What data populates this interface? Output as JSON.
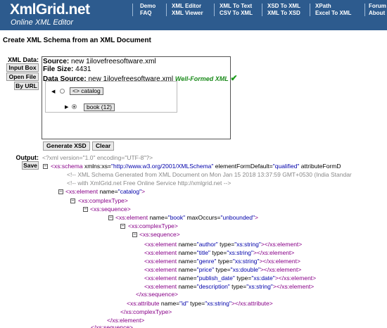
{
  "header": {
    "logo": "XmlGrid.net",
    "tagline": "Online XML Editor",
    "nav": [
      [
        "Demo",
        "FAQ"
      ],
      [
        "XML Editor",
        "XML Viewer"
      ],
      [
        "XML To Text",
        "CSV To XML"
      ],
      [
        "XSD To XML",
        "XML To XSD"
      ],
      [
        "XPath",
        "Excel To XML"
      ],
      [
        "Forum",
        "About"
      ]
    ]
  },
  "page_title": "Create XML Schema from an XML Document",
  "xml_data": {
    "label": "XML Data:",
    "buttons": {
      "input_box": "Input Box",
      "open_file": "Open File",
      "by_url": "By URL"
    },
    "source_label": "Source:",
    "source_value": "new 1ilovefreesoftware.xml",
    "filesize_label": "File Size:",
    "filesize_value": "4431",
    "datasource_label": "Data Source:",
    "datasource_value": "new 1ilovefreesoftware.xml",
    "wellformed": "Well-Formed XML",
    "checkmark": "✔",
    "tree": {
      "root": "<> catalog",
      "child": "book (12)"
    }
  },
  "actions": {
    "generate": "Generate XSD",
    "clear": "Clear"
  },
  "output": {
    "label": "Output:",
    "save": "Save",
    "lines": [
      [
        [
          "pi",
          "<?xml version=\"1.0\" encoding=\"UTF-8\"?>"
        ]
      ],
      [
        [
          "tg",
          "<xs:schema "
        ],
        [
          "at",
          "xmlns:xs="
        ],
        [
          "vl",
          "\"http://www.w3.org/2001/XMLSchema\""
        ],
        [
          "at",
          " elementFormDefault="
        ],
        [
          "vl",
          "\"qualified\""
        ],
        [
          "at",
          " attributeFormD"
        ]
      ],
      [
        [
          "cm",
          "<!-- XML Schema Generated from XML Document on Mon Jan 15 2018 13:37:59 GMT+0530 (India Standar"
        ]
      ],
      [
        [
          "cm",
          "<!-- with XmlGrid.net Free Online Service http://xmlgrid.net -->"
        ]
      ],
      [
        [
          "tg",
          "<xs:element "
        ],
        [
          "at",
          "name="
        ],
        [
          "vl",
          "\"catalog\""
        ],
        [
          "tg",
          ">"
        ]
      ],
      [
        [
          "tg",
          "<xs:complexType>"
        ]
      ],
      [
        [
          "tg",
          "<xs:sequence>"
        ]
      ],
      [
        [
          "tg",
          "<xs:element "
        ],
        [
          "at",
          "name="
        ],
        [
          "vl",
          "\"book\""
        ],
        [
          "at",
          " maxOccurs="
        ],
        [
          "vl",
          "\"unbounded\""
        ],
        [
          "tg",
          ">"
        ]
      ],
      [
        [
          "tg",
          "<xs:complexType>"
        ]
      ],
      [
        [
          "tg",
          "<xs:sequence>"
        ]
      ],
      [
        [
          "tg",
          "<xs:element "
        ],
        [
          "at",
          "name="
        ],
        [
          "vl",
          "\"author\""
        ],
        [
          "at",
          " type="
        ],
        [
          "vl",
          "\"xs:string\""
        ],
        [
          "tg",
          "></xs:element>"
        ]
      ],
      [
        [
          "tg",
          "<xs:element "
        ],
        [
          "at",
          "name="
        ],
        [
          "vl",
          "\"title\""
        ],
        [
          "at",
          " type="
        ],
        [
          "vl",
          "\"xs:string\""
        ],
        [
          "tg",
          "></xs:element>"
        ]
      ],
      [
        [
          "tg",
          "<xs:element "
        ],
        [
          "at",
          "name="
        ],
        [
          "vl",
          "\"genre\""
        ],
        [
          "at",
          " type="
        ],
        [
          "vl",
          "\"xs:string\""
        ],
        [
          "tg",
          "></xs:element>"
        ]
      ],
      [
        [
          "tg",
          "<xs:element "
        ],
        [
          "at",
          "name="
        ],
        [
          "vl",
          "\"price\""
        ],
        [
          "at",
          " type="
        ],
        [
          "vl",
          "\"xs:double\""
        ],
        [
          "tg",
          "></xs:element>"
        ]
      ],
      [
        [
          "tg",
          "<xs:element "
        ],
        [
          "at",
          "name="
        ],
        [
          "vl",
          "\"publish_date\""
        ],
        [
          "at",
          " type="
        ],
        [
          "vl",
          "\"xs:date\""
        ],
        [
          "tg",
          "></xs:element>"
        ]
      ],
      [
        [
          "tg",
          "<xs:element "
        ],
        [
          "at",
          "name="
        ],
        [
          "vl",
          "\"description\""
        ],
        [
          "at",
          " type="
        ],
        [
          "vl",
          "\"xs:string\""
        ],
        [
          "tg",
          "></xs:element>"
        ]
      ],
      [
        [
          "tg",
          "</xs:sequence>"
        ]
      ],
      [
        [
          "tg",
          "<xs:attribute "
        ],
        [
          "at",
          "name="
        ],
        [
          "vl",
          "\"id\""
        ],
        [
          "at",
          " type="
        ],
        [
          "vl",
          "\"xs:string\""
        ],
        [
          "tg",
          "></xs:attribute>"
        ]
      ],
      [
        [
          "tg",
          "</xs:complexType>"
        ]
      ],
      [
        [
          "tg",
          "</xs:element>"
        ]
      ],
      [
        [
          "tg",
          "</xs:sequence>"
        ]
      ]
    ]
  },
  "colors": {
    "header_bg": "#2d5b8e",
    "tag": "#880088",
    "value": "#0000aa",
    "comment": "#888888",
    "wellformed": "#1a8a1a"
  }
}
